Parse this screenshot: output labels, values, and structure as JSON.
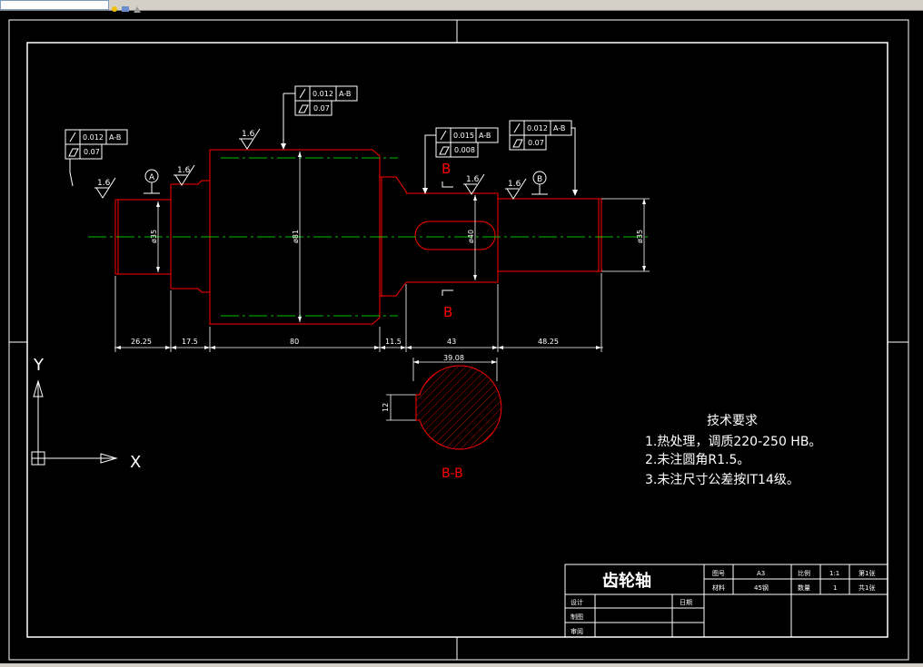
{
  "drawing": {
    "dimensions": {
      "d_left_shaft": "ø35",
      "d_gear": "ø81",
      "d_keyway_section": "ø40",
      "d_right_shaft": "ø35",
      "len_1": "26.25",
      "len_2": "17.5",
      "len_3": "80",
      "len_4": "11.5",
      "len_5": "43",
      "len_6": "48.25",
      "key_width": "39.08",
      "key_depth": "12"
    },
    "roughness": {
      "r1": "1.6",
      "r2": "1.6",
      "r3": "1.6",
      "r4": "1.6",
      "r5": "1.6"
    },
    "datums": {
      "a": "A",
      "b": "B"
    },
    "tolerance_frames": {
      "f1": {
        "runout": "0.012",
        "datum": "A-B",
        "cyl": "0.07"
      },
      "f2": {
        "runout": "0.012",
        "datum": "A-B",
        "cyl": "0.07"
      },
      "f3": {
        "runout": "0.015",
        "datum": "A-B",
        "cyl": "0.008"
      },
      "f4": {
        "runout": "0.012",
        "datum": "A-B",
        "cyl": "0.07"
      }
    },
    "section": {
      "mark_top": "B",
      "mark_bottom": "B",
      "label": "B-B"
    },
    "ucs": {
      "y": "Y",
      "x": "X"
    }
  },
  "tech_requirements": {
    "title": "技术要求",
    "items": [
      "1.热处理，调质220-250 HB。",
      "2.未注圆角R1.5。",
      "3.未注尺寸公差按IT14级。"
    ]
  },
  "title_block": {
    "part_name": "齿轮轴",
    "drawing_no_label": "图号",
    "drawing_no": "A3",
    "scale_label": "比例",
    "scale": "1:1",
    "sheet_label": "第1张",
    "material_label": "材料",
    "material": "45钢",
    "qty_label": "数量",
    "qty": "1",
    "total_label": "共1张",
    "design_label": "设计",
    "drawn_label": "制图",
    "check_label": "审阅",
    "date_label": "日期"
  },
  "colors": {
    "outline": "#ff0000",
    "dims": "#ffffff",
    "center": "#00ff00",
    "frame": "#ffffff",
    "cyan": "#00ffff"
  }
}
